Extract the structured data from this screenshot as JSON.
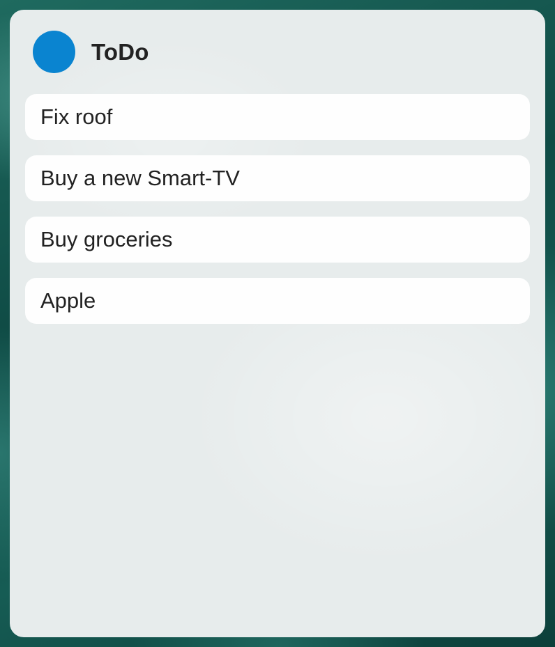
{
  "widget": {
    "title": "ToDo",
    "accent_color": "#0a84d0"
  },
  "items": [
    {
      "label": "Fix roof"
    },
    {
      "label": "Buy a new Smart-TV"
    },
    {
      "label": "Buy groceries"
    },
    {
      "label": "Apple"
    }
  ]
}
